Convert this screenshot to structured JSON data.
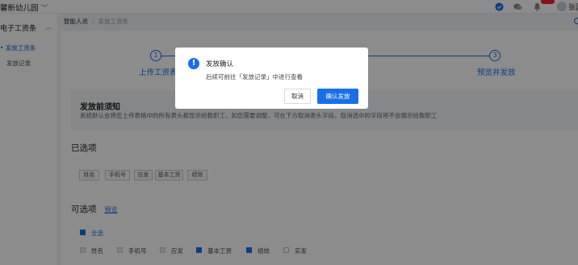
{
  "topbar": {
    "org_name": "馨新幼儿园",
    "user_name": "张园"
  },
  "sidebar": {
    "section": "电子工资条",
    "items": [
      {
        "label": "• 发放工资条",
        "active": true
      },
      {
        "label": "发放记录",
        "active": false
      }
    ]
  },
  "breadcrumb": [
    "智能人资",
    "发放工资条"
  ],
  "steps": [
    {
      "num": "1",
      "label": "上传工资表"
    },
    {
      "num": "3",
      "label": "预览并发放"
    }
  ],
  "notice": {
    "title": "发放前须知",
    "text": "系统默认会将您上传表格中的所有表头都显示给教职工，如您需要调整，可在下方取消表头字段，取消选中的字段将不会展示给教职工"
  },
  "selected": {
    "title": "已选项",
    "tags": [
      "姓名",
      "手机号",
      "应发",
      "基本工资",
      "绩效"
    ]
  },
  "options": {
    "title": "可选项",
    "preview_link": "预览",
    "select_all": "全选",
    "items": [
      {
        "label": "姓名",
        "state": "disabled"
      },
      {
        "label": "手机号",
        "state": "disabled"
      },
      {
        "label": "应发",
        "state": "disabled"
      },
      {
        "label": "基本工资",
        "state": "checked"
      },
      {
        "label": "绩效",
        "state": "checked"
      },
      {
        "label": "实发",
        "state": "unchecked"
      }
    ]
  },
  "modal": {
    "title": "发放确认",
    "description": "后续可前往「发放记录」中进行查看",
    "cancel_label": "取消",
    "confirm_label": "确认发放",
    "icon": "exclamation-icon"
  },
  "colors": {
    "accent": "#1a6fe8",
    "overlay": "rgba(0,0,0,0.45)"
  }
}
